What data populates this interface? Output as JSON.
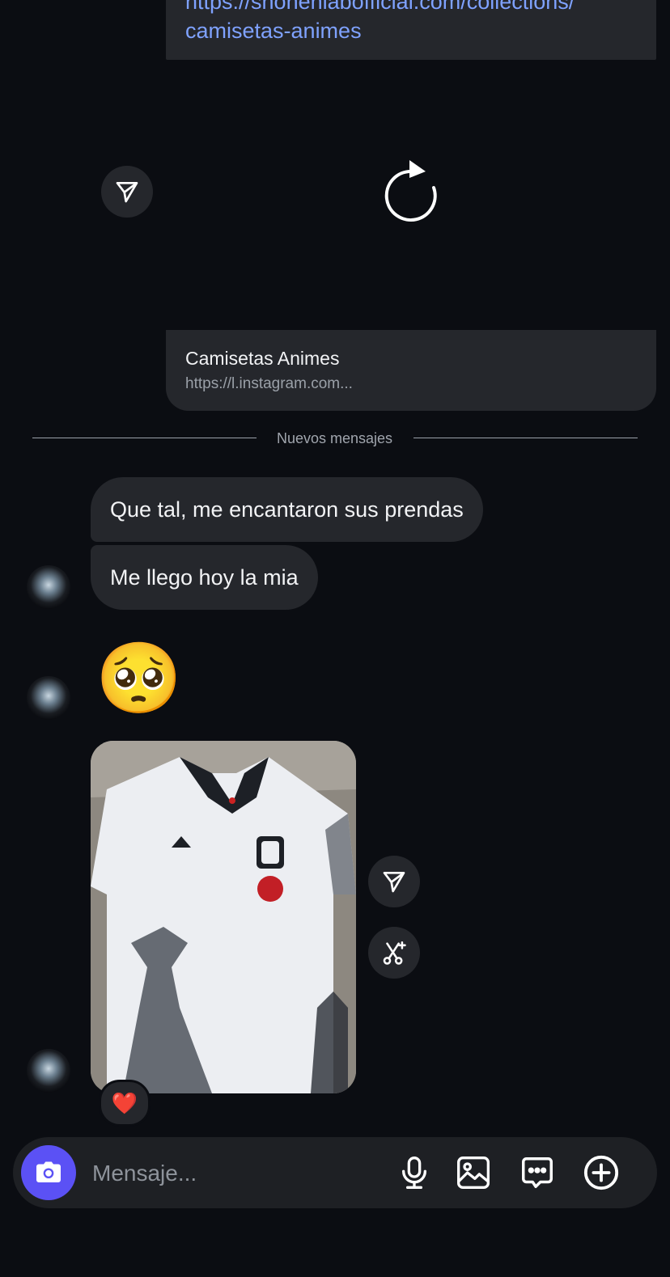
{
  "shared_link_card": {
    "url_text": "https://shonenlabofficial.com/collections/\ncamisetas-animes",
    "title": "Camisetas Animes",
    "url": "https://l.instagram.com..."
  },
  "divider": {
    "label": "Nuevos mensajes"
  },
  "messages": [
    {
      "text": "Que tal, me encantaron sus prendas"
    },
    {
      "text": "Me llego hoy la mia"
    }
  ],
  "emoji_message": {
    "emoji": "🥺"
  },
  "photo_message": {
    "reaction": "❤️",
    "icons": [
      "send-icon",
      "remix-icon"
    ]
  },
  "composer": {
    "placeholder": "Mensaje..."
  },
  "colors": {
    "background": "#0b0d12",
    "bubble": "#25272c",
    "accent": "#5b51f5",
    "link": "#7fa2ff"
  }
}
